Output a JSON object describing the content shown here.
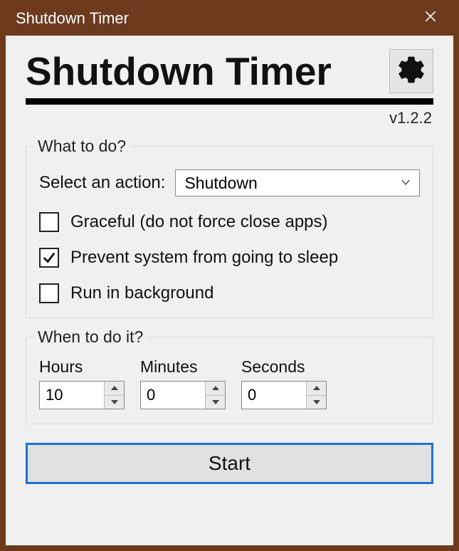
{
  "window": {
    "title": "Shutdown Timer"
  },
  "header": {
    "app_title": "Shutdown Timer",
    "version": "v1.2.2"
  },
  "group_what": {
    "legend": "What to do?",
    "action_label": "Select an action:",
    "action_value": "Shutdown",
    "checkboxes": [
      {
        "label": "Graceful (do not force close apps)",
        "checked": false
      },
      {
        "label": "Prevent system from going to sleep",
        "checked": true
      },
      {
        "label": "Run in background",
        "checked": false
      }
    ]
  },
  "group_when": {
    "legend": "When to do it?",
    "fields": {
      "hours": {
        "label": "Hours",
        "value": "10"
      },
      "minutes": {
        "label": "Minutes",
        "value": "0"
      },
      "seconds": {
        "label": "Seconds",
        "value": "0"
      }
    }
  },
  "start_label": "Start"
}
